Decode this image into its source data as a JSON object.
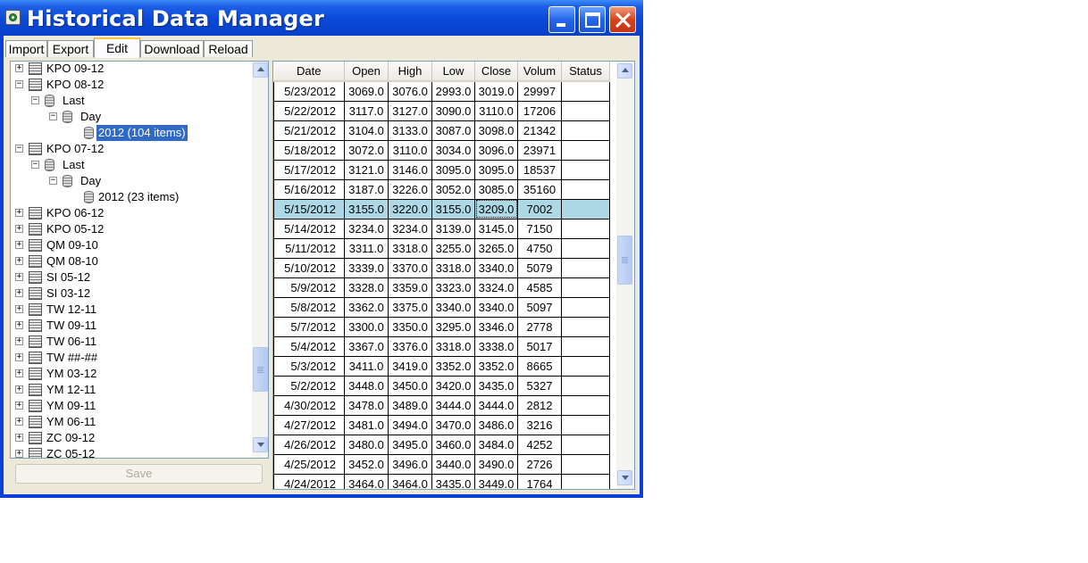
{
  "window": {
    "title": "Historical Data Manager"
  },
  "toolbar": {
    "tabs": [
      {
        "label": "Import"
      },
      {
        "label": "Export"
      },
      {
        "label": "Edit"
      },
      {
        "label": "Download"
      },
      {
        "label": "Reload"
      }
    ],
    "active_tab": "Edit"
  },
  "tree": {
    "items": [
      {
        "label": "KPO 09-12",
        "level": 0,
        "expander": "+",
        "icon": "database-stack-icon"
      },
      {
        "label": "KPO 08-12",
        "level": 0,
        "expander": "−",
        "icon": "database-stack-icon"
      },
      {
        "label": "Last",
        "level": 1,
        "expander": "−",
        "icon": "database-icon"
      },
      {
        "label": "Day",
        "level": 2,
        "expander": "−",
        "icon": "database-icon"
      },
      {
        "label": "2012 (104 items)",
        "level": 3,
        "expander": "",
        "icon": "database-icon",
        "selected": true
      },
      {
        "label": "KPO 07-12",
        "level": 0,
        "expander": "−",
        "icon": "database-stack-icon"
      },
      {
        "label": "Last",
        "level": 1,
        "expander": "−",
        "icon": "database-icon"
      },
      {
        "label": "Day",
        "level": 2,
        "expander": "−",
        "icon": "database-icon"
      },
      {
        "label": "2012 (23 items)",
        "level": 3,
        "expander": "",
        "icon": "database-icon"
      },
      {
        "label": "KPO 06-12",
        "level": 0,
        "expander": "+",
        "icon": "database-stack-icon"
      },
      {
        "label": "KPO 05-12",
        "level": 0,
        "expander": "+",
        "icon": "database-stack-icon"
      },
      {
        "label": "QM 09-10",
        "level": 0,
        "expander": "+",
        "icon": "database-stack-icon"
      },
      {
        "label": "QM 08-10",
        "level": 0,
        "expander": "+",
        "icon": "database-stack-icon"
      },
      {
        "label": "SI 05-12",
        "level": 0,
        "expander": "+",
        "icon": "database-stack-icon"
      },
      {
        "label": "SI 03-12",
        "level": 0,
        "expander": "+",
        "icon": "database-stack-icon"
      },
      {
        "label": "TW 12-11",
        "level": 0,
        "expander": "+",
        "icon": "database-stack-icon"
      },
      {
        "label": "TW 09-11",
        "level": 0,
        "expander": "+",
        "icon": "database-stack-icon"
      },
      {
        "label": "TW 06-11",
        "level": 0,
        "expander": "+",
        "icon": "database-stack-icon"
      },
      {
        "label": "TW ##-##",
        "level": 0,
        "expander": "+",
        "icon": "database-stack-icon"
      },
      {
        "label": "YM 03-12",
        "level": 0,
        "expander": "+",
        "icon": "database-stack-icon"
      },
      {
        "label": "YM 12-11",
        "level": 0,
        "expander": "+",
        "icon": "database-stack-icon"
      },
      {
        "label": "YM 09-11",
        "level": 0,
        "expander": "+",
        "icon": "database-stack-icon"
      },
      {
        "label": "YM 06-11",
        "level": 0,
        "expander": "+",
        "icon": "database-stack-icon"
      },
      {
        "label": "ZC 09-12",
        "level": 0,
        "expander": "+",
        "icon": "database-stack-icon"
      },
      {
        "label": "ZC 05-12",
        "level": 0,
        "expander": "+",
        "icon": "database-stack-icon"
      }
    ]
  },
  "save_button": {
    "label": "Save",
    "enabled": false
  },
  "grid": {
    "columns": [
      "Date",
      "Open",
      "High",
      "Low",
      "Close",
      "Volum",
      "Status"
    ],
    "selected_row": 6,
    "focused_cell": {
      "row": 6,
      "col": 4
    },
    "rows": [
      [
        "5/23/2012",
        "3069.0",
        "3076.0",
        "2993.0",
        "3019.0",
        "29997",
        ""
      ],
      [
        "5/22/2012",
        "3117.0",
        "3127.0",
        "3090.0",
        "3110.0",
        "17206",
        ""
      ],
      [
        "5/21/2012",
        "3104.0",
        "3133.0",
        "3087.0",
        "3098.0",
        "21342",
        ""
      ],
      [
        "5/18/2012",
        "3072.0",
        "3110.0",
        "3034.0",
        "3096.0",
        "23971",
        ""
      ],
      [
        "5/17/2012",
        "3121.0",
        "3146.0",
        "3095.0",
        "3095.0",
        "18537",
        ""
      ],
      [
        "5/16/2012",
        "3187.0",
        "3226.0",
        "3052.0",
        "3085.0",
        "35160",
        ""
      ],
      [
        "5/15/2012",
        "3155.0",
        "3220.0",
        "3155.0",
        "3209.0",
        "7002",
        ""
      ],
      [
        "5/14/2012",
        "3234.0",
        "3234.0",
        "3139.0",
        "3145.0",
        "7150",
        ""
      ],
      [
        "5/11/2012",
        "3311.0",
        "3318.0",
        "3255.0",
        "3265.0",
        "4750",
        ""
      ],
      [
        "5/10/2012",
        "3339.0",
        "3370.0",
        "3318.0",
        "3340.0",
        "5079",
        ""
      ],
      [
        "5/9/2012",
        "3328.0",
        "3359.0",
        "3323.0",
        "3324.0",
        "4585",
        ""
      ],
      [
        "5/8/2012",
        "3362.0",
        "3375.0",
        "3340.0",
        "3340.0",
        "5097",
        ""
      ],
      [
        "5/7/2012",
        "3300.0",
        "3350.0",
        "3295.0",
        "3346.0",
        "2778",
        ""
      ],
      [
        "5/4/2012",
        "3367.0",
        "3376.0",
        "3318.0",
        "3338.0",
        "5017",
        ""
      ],
      [
        "5/3/2012",
        "3411.0",
        "3419.0",
        "3352.0",
        "3352.0",
        "8665",
        ""
      ],
      [
        "5/2/2012",
        "3448.0",
        "3450.0",
        "3420.0",
        "3435.0",
        "5327",
        ""
      ],
      [
        "4/30/2012",
        "3478.0",
        "3489.0",
        "3444.0",
        "3444.0",
        "2812",
        ""
      ],
      [
        "4/27/2012",
        "3481.0",
        "3494.0",
        "3470.0",
        "3486.0",
        "3216",
        ""
      ],
      [
        "4/26/2012",
        "3480.0",
        "3495.0",
        "3460.0",
        "3484.0",
        "4252",
        ""
      ],
      [
        "4/25/2012",
        "3452.0",
        "3496.0",
        "3440.0",
        "3490.0",
        "2726",
        ""
      ],
      [
        "4/24/2012",
        "3464.0",
        "3464.0",
        "3435.0",
        "3449.0",
        "1764",
        ""
      ]
    ]
  },
  "colors": {
    "titlebar": "#0a48d8",
    "selected_tree_item": "#316ac5",
    "selected_grid_row": "#add8e6",
    "active_tab_highlight": "#ffc83c"
  }
}
